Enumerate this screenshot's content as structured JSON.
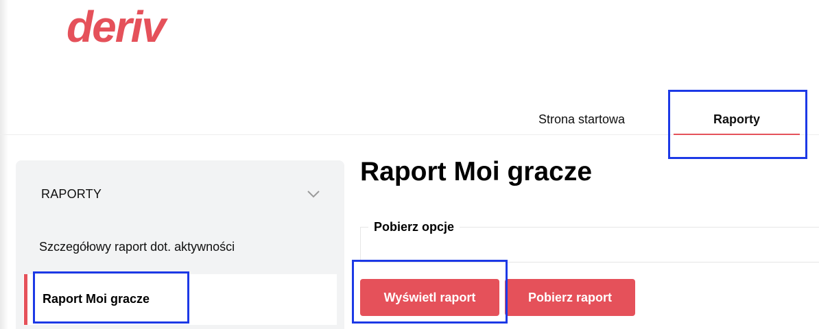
{
  "brand": {
    "logo_text": "deriv",
    "accent_color": "#e5515a",
    "highlight_color": "#1c39e6"
  },
  "nav": {
    "items": [
      {
        "label": "Strona startowa",
        "active": false
      },
      {
        "label": "Raporty",
        "active": true
      }
    ]
  },
  "sidebar": {
    "section_title": "RAPORTY",
    "section_icon": "chevron-down-icon",
    "items": [
      {
        "label": "Szczegółowy raport dot. aktywności",
        "active": false
      },
      {
        "label": "Raport Moi gracze",
        "active": true
      }
    ]
  },
  "main": {
    "title": "Raport Moi gracze",
    "options_legend": "Pobierz opcje",
    "buttons": {
      "view_report": "Wyświetl raport",
      "download_report": "Pobierz raport"
    }
  }
}
